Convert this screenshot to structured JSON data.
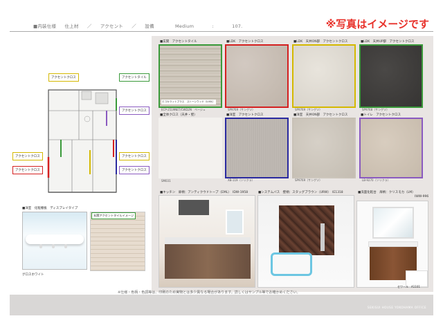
{
  "header": {
    "section": "■内装仕様",
    "crumb1": "仕上材",
    "sep1": "／",
    "crumb2": "アクセント",
    "sep2": "／",
    "crumb3": "設備",
    "plan_name": "Medium",
    "plan_sep": ":",
    "plan_no": "107.",
    "notice": "※写真はイメージです"
  },
  "plan_tags": {
    "t1": "アクセントクロス",
    "t2": "アクセントタイル",
    "t3": "アクセントクロス",
    "t4": "アクセントクロス",
    "t5": "アクセントクロス",
    "t6": "アクセントクロス",
    "t7": "アクセントクロス"
  },
  "bottom_left": {
    "shelf_label": "■洋室　化粧棚板　ディスプレイタイプ",
    "shelf_color": "グロスホワイト",
    "tile_label": "玄関アクセントタイルイメージ"
  },
  "swatches": [
    {
      "label": "■玄関　アクセントタイル",
      "code": "ECP-2519NET/CWD2N　ベージュ",
      "overlay": "エコカラットプラス　ストーンウッド（LIXIL）"
    },
    {
      "label": "■LDK　アクセントクロス",
      "code": "SP9769（サンゲツ）"
    },
    {
      "label": "■LDK　天井ON部　アクセントクロス",
      "code": "SP9769（サンゲツ）"
    },
    {
      "label": "■LDK　天井UP部　アクセントクロス",
      "code": "SP9768（サンゲツ）"
    },
    {
      "label": "■全体クロス（天井・壁）",
      "code": "SM031"
    },
    {
      "label": "■洋室　アクセントクロス",
      "code": "XB-119（ソリクラ）"
    },
    {
      "label": "■洋室　天井ON部　アクセントクロス",
      "code": "SP9769（サンゲツ）"
    },
    {
      "label": "■トイレ　アクセントクロス",
      "code": "LB-9270（ソリクラ）"
    }
  ],
  "photos": {
    "kitchen": "■キッチン　扉柄：アンティクウドトープ（EML）　IDW-1958",
    "bath": "■システムバス　壁柄：スタッグブラウン（URW）　IE1318",
    "vanity": "■洗面化粧台　扉柄：クリスモカ（LM）",
    "vanity_code": "IWW-996",
    "floor": "セワール　A1101"
  },
  "footnote": "※仕様・色柄・色調等は、印刷のため実物とは多少異なる場合があります。詳しくはサンプル等でお確かめください。",
  "footer": {
    "brand": "SEKISUI HOUSE YOKOHAMA OFFICE"
  },
  "colors": {
    "notice": "#e8312a",
    "green": "#3a9a3a",
    "red": "#d42020",
    "yellow": "#d4b800",
    "blue": "#2a2aa0",
    "purple": "#8a5ac0"
  }
}
